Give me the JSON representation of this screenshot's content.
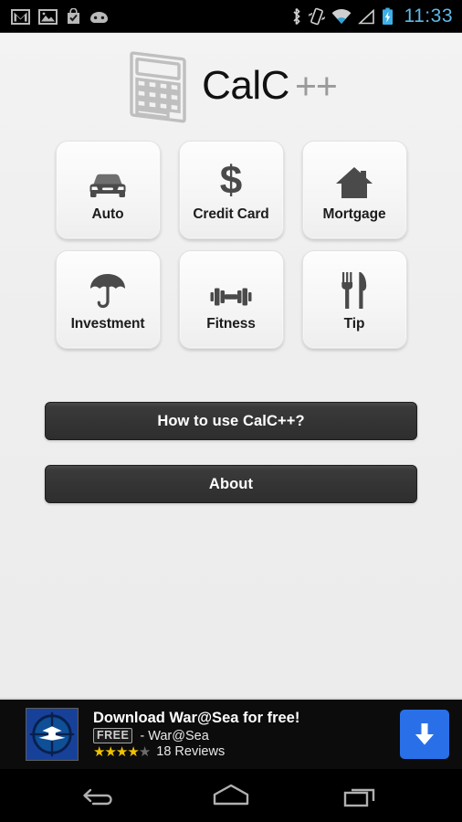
{
  "status_bar": {
    "left_icons": [
      "gmail-icon",
      "photos-icon",
      "play-store-icon",
      "android-head-icon"
    ],
    "right_icons": [
      "bluetooth-icon",
      "vibrate-icon",
      "wifi-icon",
      "cell-signal-icon",
      "battery-charging-icon"
    ],
    "clock": "11:33",
    "clock_color": "#5fb9e8"
  },
  "app": {
    "logo_name": "CalC",
    "logo_suffix": "++",
    "logo_icon": "calculator-icon"
  },
  "grid": {
    "tiles": [
      {
        "label": "Auto",
        "icon": "car-icon"
      },
      {
        "label": "Credit Card",
        "icon": "dollar-sign-icon"
      },
      {
        "label": "Mortgage",
        "icon": "house-icon"
      },
      {
        "label": "Investment",
        "icon": "umbrella-icon"
      },
      {
        "label": "Fitness",
        "icon": "dumbbell-icon"
      },
      {
        "label": "Tip",
        "icon": "fork-knife-icon"
      }
    ]
  },
  "actions": {
    "how_to_use": "How to use CalC++?",
    "about": "About"
  },
  "ad": {
    "title": "Download War@Sea for free!",
    "badge": "FREE",
    "advertiser": "- War@Sea",
    "rating": 4,
    "rating_max": 5,
    "reviews": "18 Reviews",
    "cta_icon": "download-arrow-icon",
    "cta_color": "#2970e8",
    "icon": "warsea-crosshair-icon"
  },
  "nav_bar": {
    "back": "back-icon",
    "home": "home-icon",
    "recents": "recents-icon"
  }
}
